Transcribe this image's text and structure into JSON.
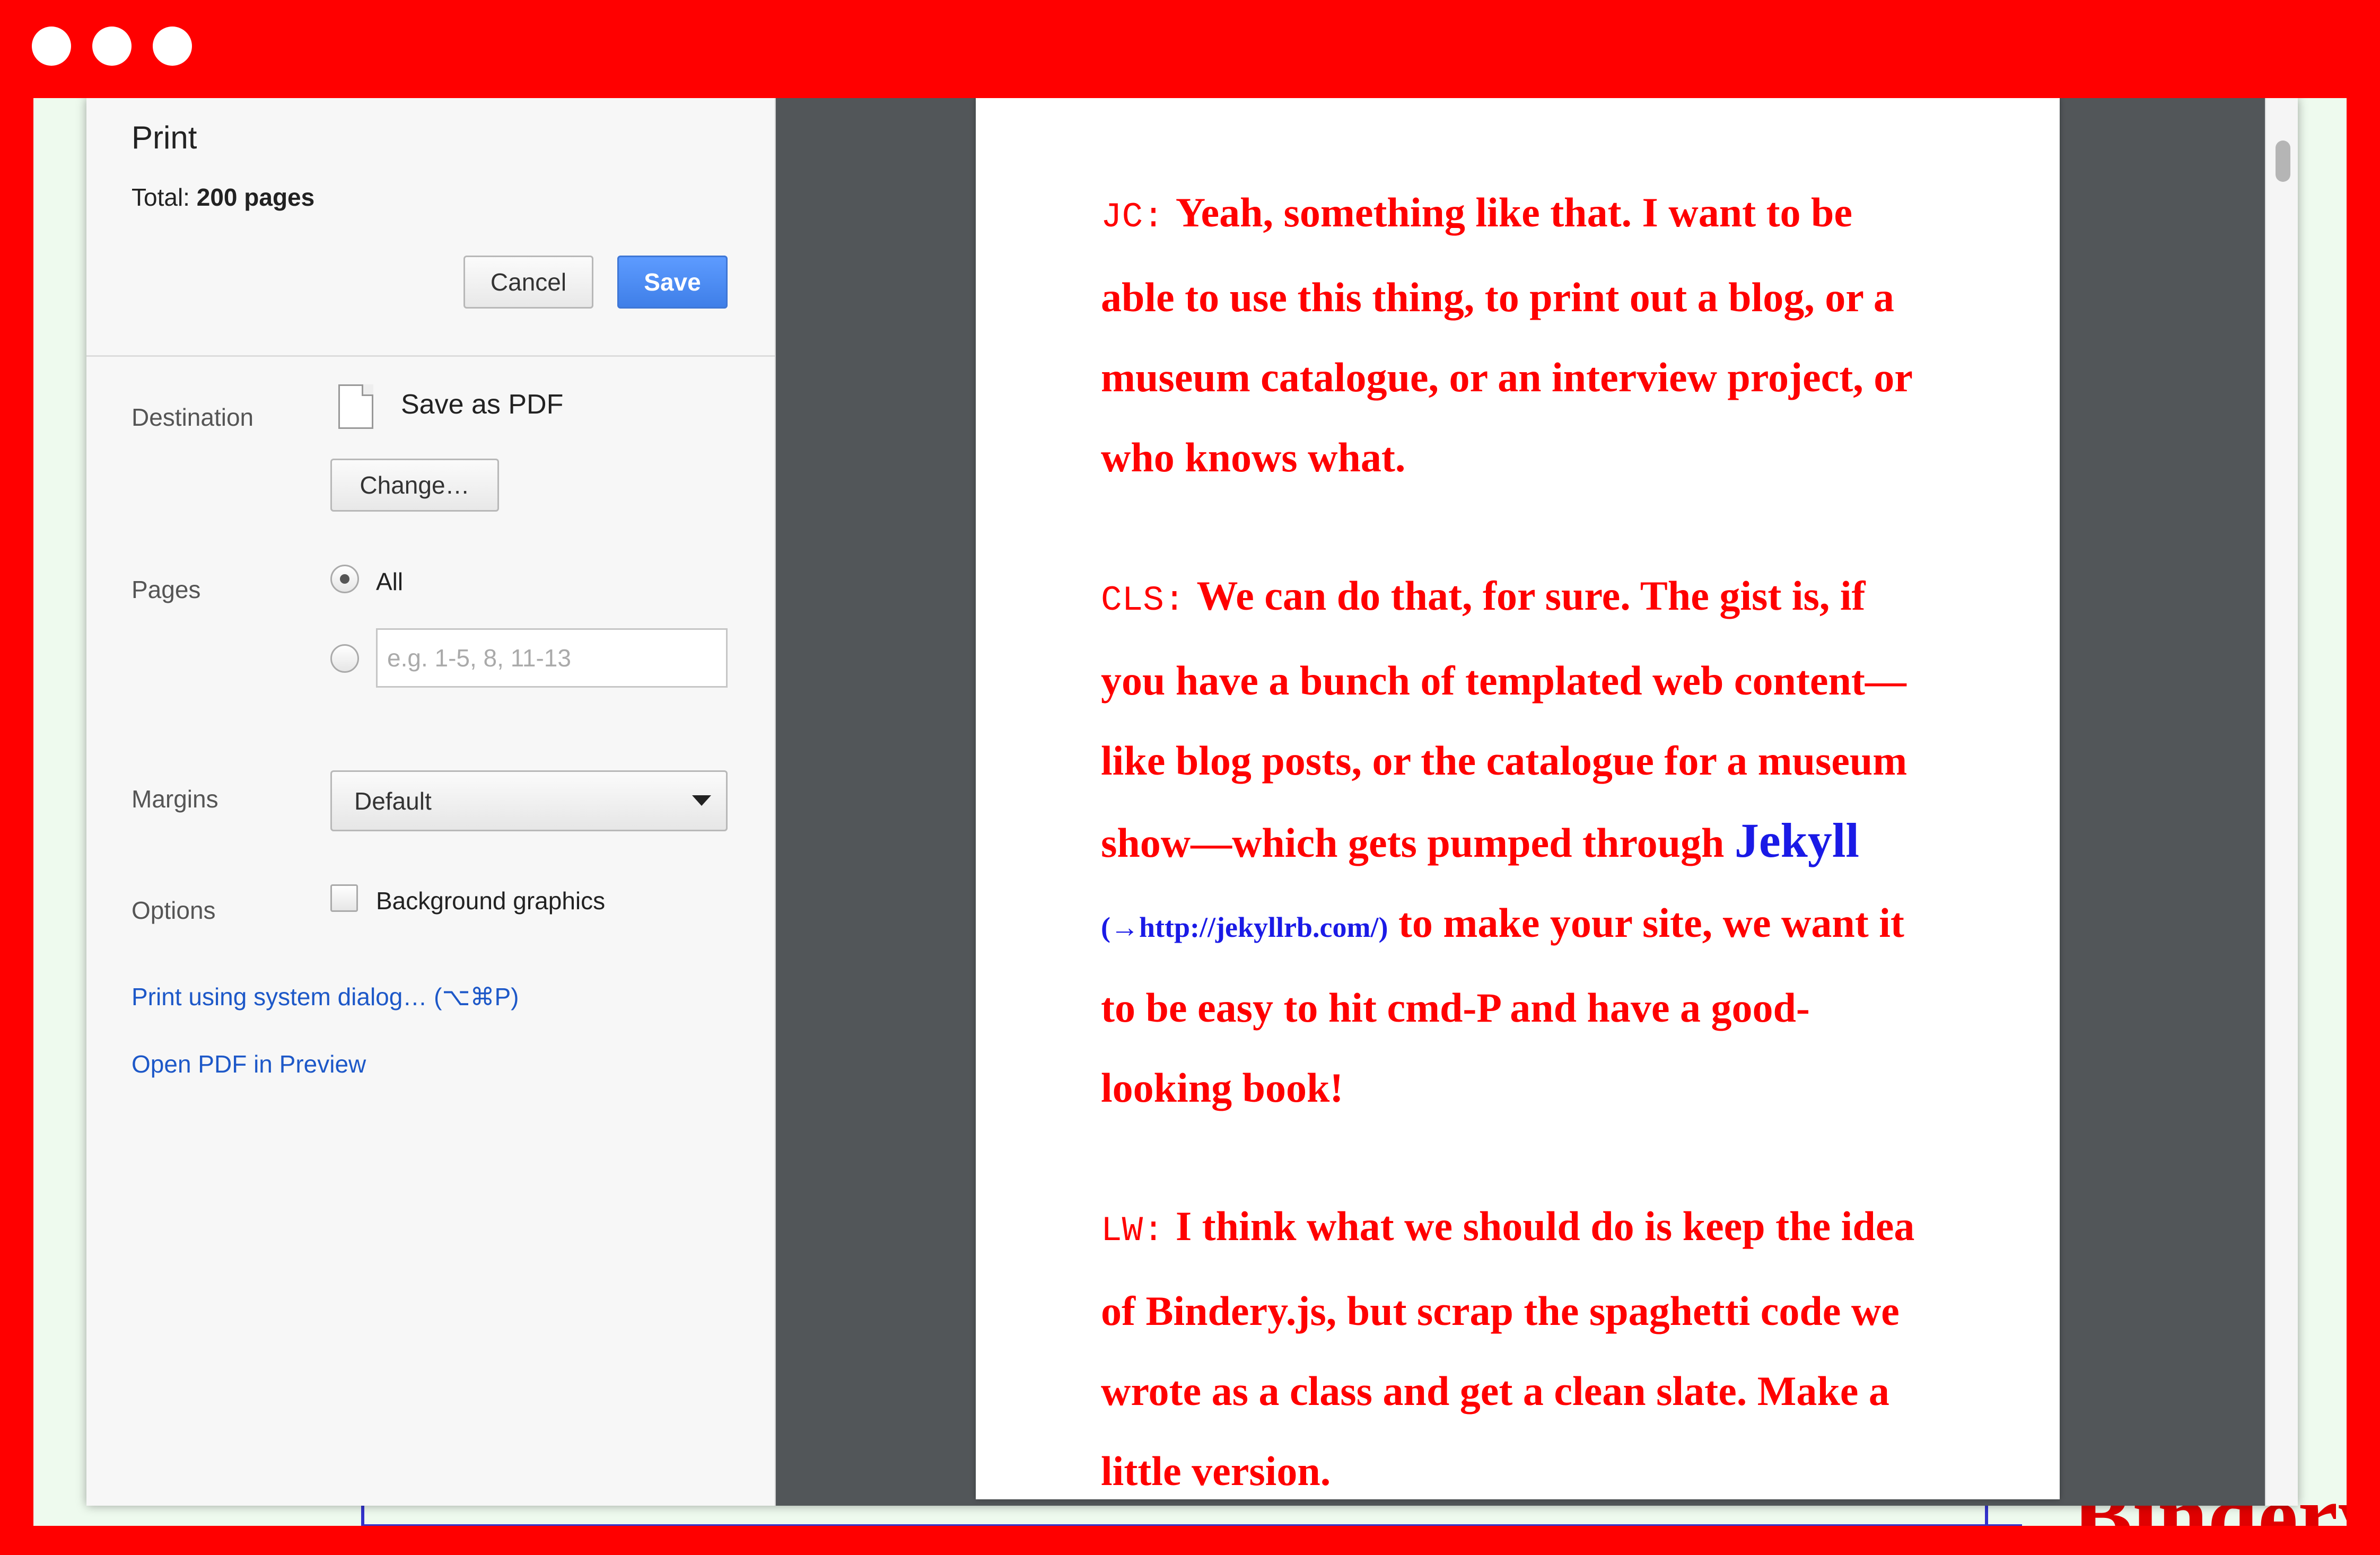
{
  "window": {
    "controls": [
      "close",
      "minimize",
      "maximize"
    ]
  },
  "background_page": {
    "title_fragment": "Bindery"
  },
  "dialog": {
    "title": "Print",
    "total_label": "Total: ",
    "total_value": "200 pages",
    "cancel_label": "Cancel",
    "save_label": "Save",
    "destination": {
      "label": "Destination",
      "value": "Save as PDF",
      "change_label": "Change…"
    },
    "pages": {
      "label": "Pages",
      "all_label": "All",
      "custom_placeholder": "e.g. 1-5, 8, 11-13",
      "selected": "All"
    },
    "margins": {
      "label": "Margins",
      "selected": "Default"
    },
    "options": {
      "label": "Options",
      "background_graphics_label": "Background graphics",
      "background_graphics_checked": false
    },
    "links": {
      "system_dialog": "Print using system dialog… (⌥⌘P)",
      "open_preview": "Open PDF in Preview"
    }
  },
  "preview": {
    "paragraphs": [
      {
        "speaker": "JC:",
        "text": "Yeah, something like that. I want to be able to use this thing, to print out a blog, or a museum catalogue, or an interview project, or who knows what."
      },
      {
        "speaker": "CLS:",
        "text_before": "We can do that, for sure. The gist is, if you have a bunch of templated web content—like blog posts, or the catalogue for a museum show—which gets pumped through ",
        "link_text": "Jekyll",
        "link_url": "(→http://jekyllrb.com/)",
        "text_after": " to make your site, we want it to be easy to hit cmd-P and have a good-looking book!"
      },
      {
        "speaker": "LW:",
        "text": "I think what we should do is keep the idea of Bindery.js, but scrap the spaghetti code we wrote as a class and get a clean slate. Make a little version."
      }
    ]
  },
  "colors": {
    "frame": "#ff0000",
    "save_button": "#4a8af4",
    "preview_bg": "#525659",
    "preview_text": "#ff0000",
    "link_text": "#1a1ae6"
  }
}
